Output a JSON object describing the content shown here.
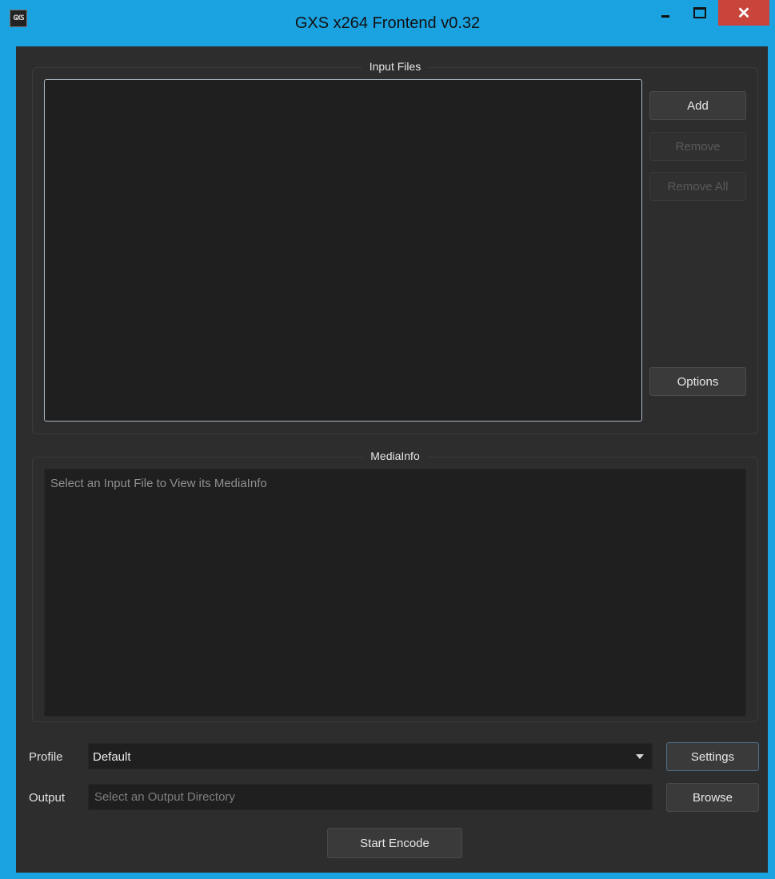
{
  "window": {
    "icon_text": "GXS",
    "title": "GXS x264 Frontend v0.32",
    "close_glyph": "✕"
  },
  "input_files": {
    "group_title": "Input Files",
    "add_label": "Add",
    "remove_label": "Remove",
    "remove_all_label": "Remove All",
    "options_label": "Options"
  },
  "mediainfo": {
    "group_title": "MediaInfo",
    "placeholder": "Select an Input File to View its MediaInfo"
  },
  "profile": {
    "label": "Profile",
    "selected": "Default",
    "settings_label": "Settings"
  },
  "output": {
    "label": "Output",
    "placeholder": "Select an Output Directory",
    "browse_label": "Browse"
  },
  "start_encode_label": "Start Encode",
  "icons": [
    "app-icon",
    "minimize-icon",
    "maximize-icon",
    "close-icon",
    "dropdown-arrow-icon"
  ],
  "colors": {
    "titlebar": "#1ba2e0",
    "close": "#c9443a",
    "window_bg": "#2d2d2d",
    "field_bg": "#1f1f1f"
  }
}
